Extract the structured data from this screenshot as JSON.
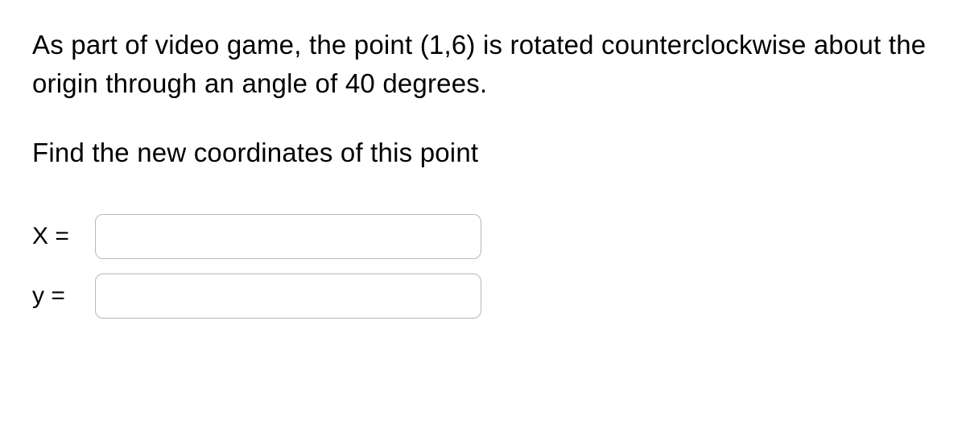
{
  "problem": {
    "statement": "As part of video game, the point (1,6) is rotated counterclockwise about the origin through an angle of 40 degrees.",
    "instruction": "Find the new coordinates of this point"
  },
  "inputs": {
    "x": {
      "label": "X =",
      "value": ""
    },
    "y": {
      "label": "y =",
      "value": ""
    }
  }
}
